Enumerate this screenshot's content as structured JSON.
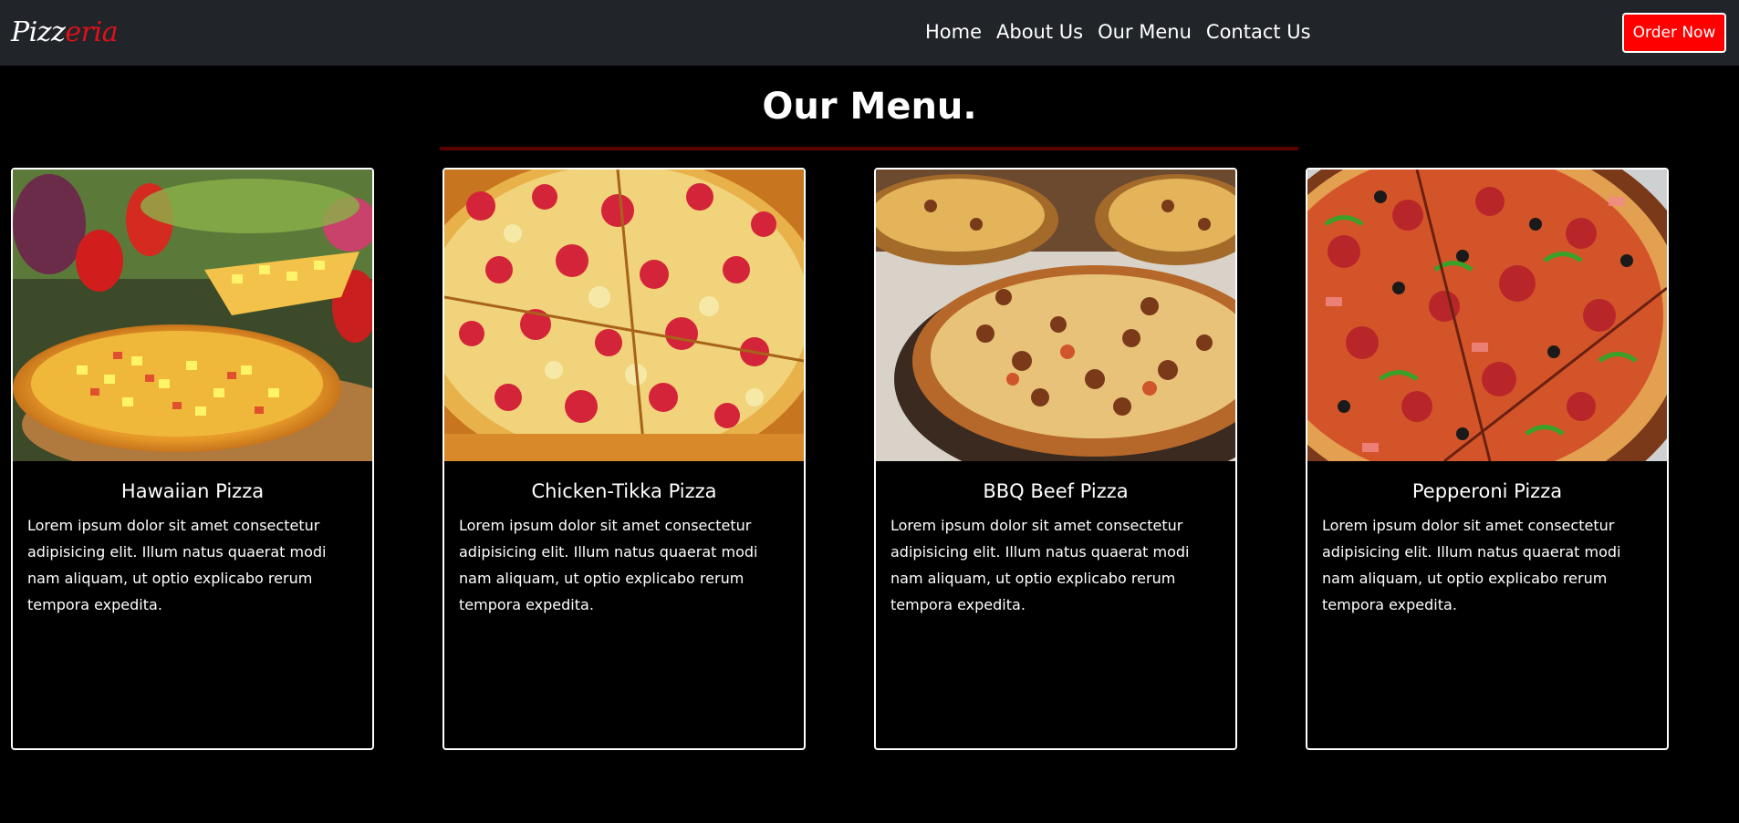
{
  "brand": {
    "part1": "Pizz",
    "part2": "eria"
  },
  "nav": {
    "links": [
      "Home",
      "About Us",
      "Our Menu",
      "Contact Us"
    ],
    "order_button": "Order Now"
  },
  "section": {
    "title": "Our Menu."
  },
  "menu_items": [
    {
      "name": "Hawaiian Pizza",
      "description": "Lorem ipsum dolor sit amet consectetur adipisicing elit. Illum natus quaerat modi nam aliquam, ut optio explicabo rerum tempora expedita.",
      "image_icon": "hawaiian-pizza-image"
    },
    {
      "name": "Chicken-Tikka Pizza",
      "description": "Lorem ipsum dolor sit amet consectetur adipisicing elit. Illum natus quaerat modi nam aliquam, ut optio explicabo rerum tempora expedita.",
      "image_icon": "chicken-tikka-pizza-image"
    },
    {
      "name": "BBQ Beef Pizza",
      "description": "Lorem ipsum dolor sit amet consectetur adipisicing elit. Illum natus quaerat modi nam aliquam, ut optio explicabo rerum tempora expedita.",
      "image_icon": "bbq-beef-pizza-image"
    },
    {
      "name": "Pepperoni Pizza",
      "description": "Lorem ipsum dolor sit amet consectetur adipisicing elit. Illum natus quaerat modi nam aliquam, ut optio explicabo rerum tempora expedita.",
      "image_icon": "pepperoni-pizza-image"
    }
  ],
  "colors": {
    "navbar_bg": "#212529",
    "accent_red": "#ff0000",
    "brand_red": "#e0101a",
    "page_bg": "#000000",
    "rule": "#5a0000"
  }
}
